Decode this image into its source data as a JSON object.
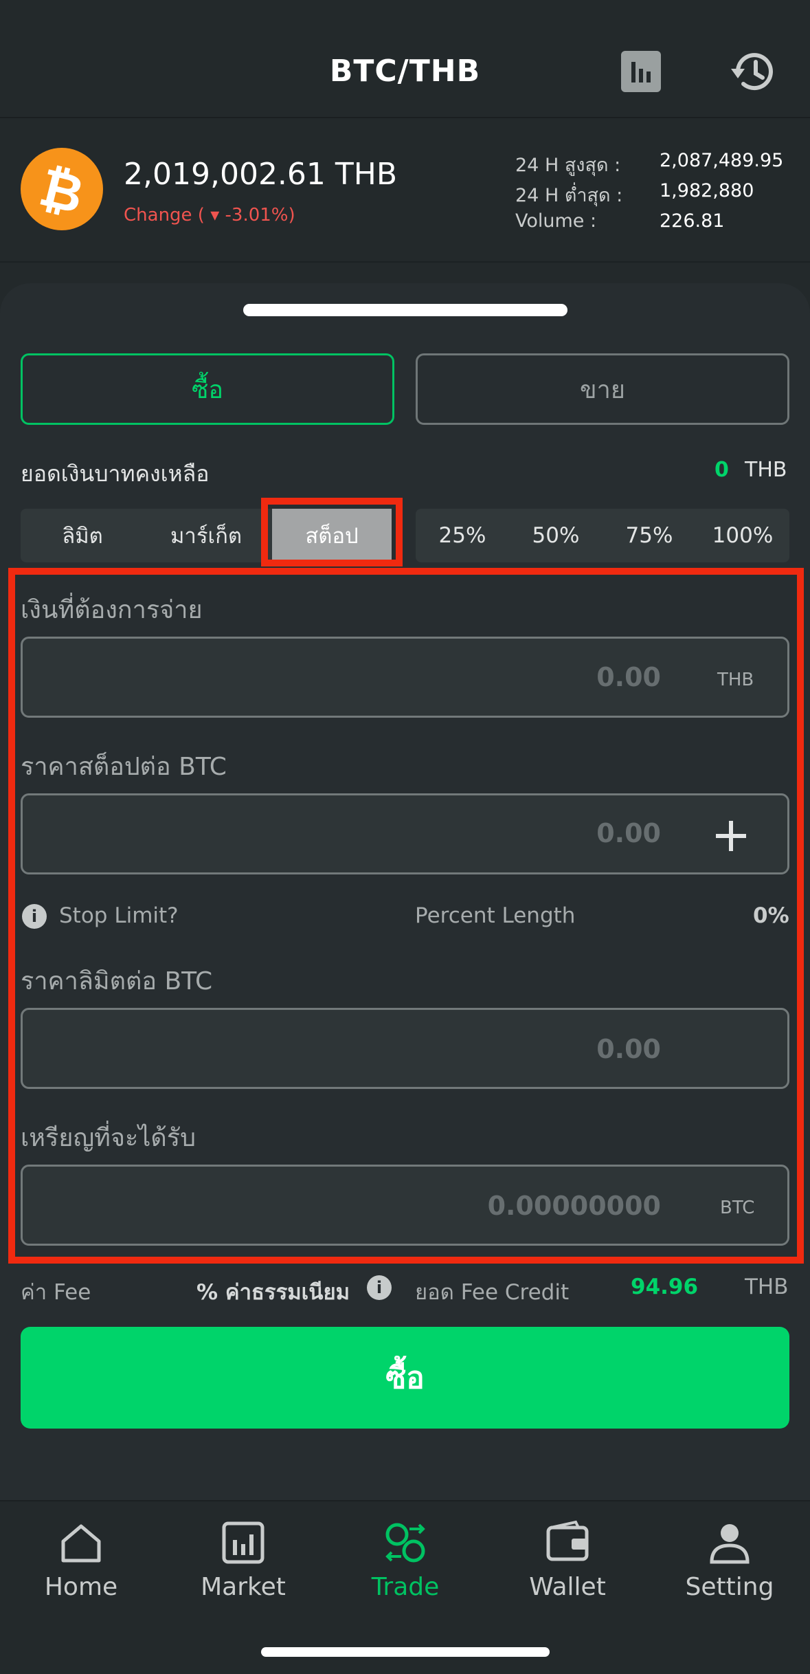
{
  "header": {
    "title": "BTC/THB",
    "chart_icon": "bar-chart-icon",
    "history_icon": "history-icon"
  },
  "ticker": {
    "coin_symbol": "₿",
    "price": "2,019,002.61 THB",
    "change": "Change ( ▾ -3.01%)",
    "stats": [
      {
        "label": "24 H สูงสุด :",
        "value": "2,087,489.95"
      },
      {
        "label": "24 H ต่ำสุด :",
        "value": "1,982,880"
      },
      {
        "label": "Volume :",
        "value": "226.81"
      }
    ]
  },
  "trade": {
    "buy_tab": "ซื้อ",
    "sell_tab": "ขาย",
    "balance_label": "ยอดเงินบาทคงเหลือ",
    "balance_value": "0",
    "balance_unit": "THB",
    "order_types": [
      "ลิมิต",
      "มาร์เก็ต",
      "สต็อป"
    ],
    "percents": [
      "25%",
      "50%",
      "75%",
      "100%"
    ],
    "fields": {
      "pay_label": "เงินที่ต้องการจ่าย",
      "pay_value": "0.00",
      "pay_unit": "THB",
      "stop_label": "ราคาสต็อปต่อ BTC",
      "stop_value": "0.00",
      "stop_limit_label": "Stop Limit?",
      "percent_length_label": "Percent Length",
      "percent_length_value": "0%",
      "limit_label": "ราคาลิมิตต่อ BTC",
      "limit_value": "0.00",
      "receive_label": "เหรียญที่จะได้รับ",
      "receive_value": "0.00000000",
      "receive_unit": "BTC"
    },
    "fee": {
      "fee_label": "ค่า Fee",
      "fee_percent_label": "% ค่าธรรมเนียม",
      "credit_label": "ยอด Fee Credit",
      "credit_value": "94.96",
      "credit_unit": "THB"
    },
    "submit_label": "ซื้อ"
  },
  "nav": {
    "items": [
      {
        "label": "Home",
        "icon": "home-icon"
      },
      {
        "label": "Market",
        "icon": "market-icon"
      },
      {
        "label": "Trade",
        "icon": "trade-icon"
      },
      {
        "label": "Wallet",
        "icon": "wallet-icon"
      },
      {
        "label": "Setting",
        "icon": "user-icon"
      }
    ],
    "active": "Trade"
  },
  "colors": {
    "accent": "#00d46a",
    "negative": "#f0544f",
    "highlight": "#f02a10",
    "bitcoin": "#f7931a"
  }
}
